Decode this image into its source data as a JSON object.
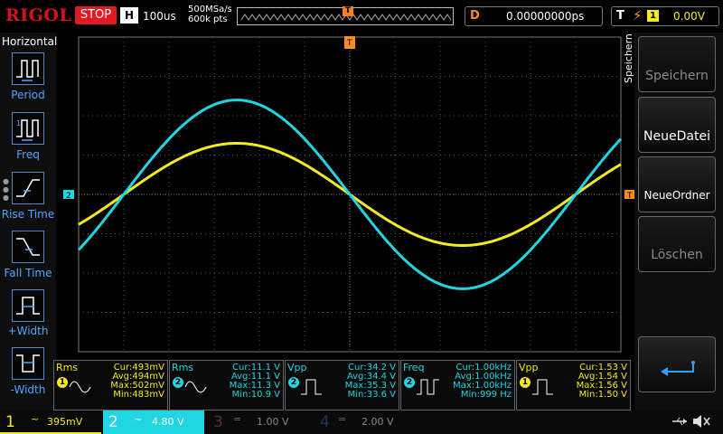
{
  "top": {
    "logo": "RIGOL",
    "run_state": "STOP",
    "mode": "H",
    "timebase": "100us",
    "sample_rate": "500MSa/s",
    "memory_depth": "600k pts",
    "trigger_marker": "T",
    "delay_tag": "D",
    "delay_value": "0.00000000ps",
    "trigger_tag": "T",
    "trigger_source": "1",
    "trigger_level": "0.00V"
  },
  "left_menu": {
    "title": "Horizontal",
    "items": [
      {
        "label": "Period",
        "icon": "period-icon"
      },
      {
        "label": "Freq",
        "icon": "freq-icon"
      },
      {
        "label": "Rise Time",
        "icon": "rise-time-icon"
      },
      {
        "label": "Fall Time",
        "icon": "fall-time-icon"
      },
      {
        "label": "+Width",
        "icon": "pos-width-icon"
      },
      {
        "label": "-Width",
        "icon": "neg-width-icon"
      }
    ]
  },
  "right_menu": {
    "title": "Speichern",
    "buttons": [
      {
        "label": "Speichern",
        "enabled": false
      },
      {
        "label": "NeueDatei",
        "enabled": true
      },
      {
        "label": "NeueOrdner",
        "enabled": true
      },
      {
        "label": "Löschen",
        "enabled": false
      },
      {
        "label": "",
        "icon": "enter-icon",
        "enabled": true
      }
    ]
  },
  "markers": {
    "ch2_offset": "2",
    "trigger_level": "T",
    "trigger_top": "T"
  },
  "colors": {
    "ch1": "#f5ea1c",
    "ch2": "#21d6e3",
    "trigger": "#ff8c1a",
    "menu_accent": "#4fa6ff"
  },
  "measurements": [
    {
      "type": "Rms",
      "source": "1",
      "rows": [
        "Cur:493mV",
        "Avg:494mV",
        "Max:502mV",
        "Min:483mV"
      ]
    },
    {
      "type": "Rms",
      "source": "2",
      "rows": [
        "Cur:11.1 V",
        "Avg:11.1 V",
        "Max:11.3 V",
        "Min:10.9 V"
      ]
    },
    {
      "type": "Vpp",
      "source": "2",
      "rows": [
        "Cur:34.2 V",
        "Avg:34.4 V",
        "Max:35.3 V",
        "Min:33.6 V"
      ]
    },
    {
      "type": "Freq",
      "source": "2",
      "rows": [
        "Cur:1.00kHz",
        "Avg:1.00kHz",
        "Max:1.00kHz",
        "Min:999 Hz"
      ]
    },
    {
      "type": "Vpp",
      "source": "1",
      "rows": [
        "Cur:1.53 V",
        "Avg:1.54 V",
        "Max:1.56 V",
        "Min:1.50 V"
      ]
    }
  ],
  "channels": [
    {
      "num": "1",
      "coupling": "~",
      "scale": "395mV",
      "active": true
    },
    {
      "num": "2",
      "coupling": "~",
      "scale": "4.80 V",
      "active": true
    },
    {
      "num": "3",
      "coupling": "=",
      "scale": "1.00 V",
      "active": false
    },
    {
      "num": "4",
      "coupling": "=",
      "scale": "2.00 V",
      "active": false
    }
  ],
  "status_icons": [
    "usb-icon",
    "speaker-muted-icon"
  ],
  "waveforms": {
    "ch1": {
      "center_div": 4.0,
      "amplitude_div": 1.3,
      "phase_deg": 180,
      "periods_on_screen": 1.2
    },
    "ch2": {
      "center_div": 4.0,
      "amplitude_div": 2.4,
      "phase_deg": 180,
      "periods_on_screen": 1.2
    }
  }
}
